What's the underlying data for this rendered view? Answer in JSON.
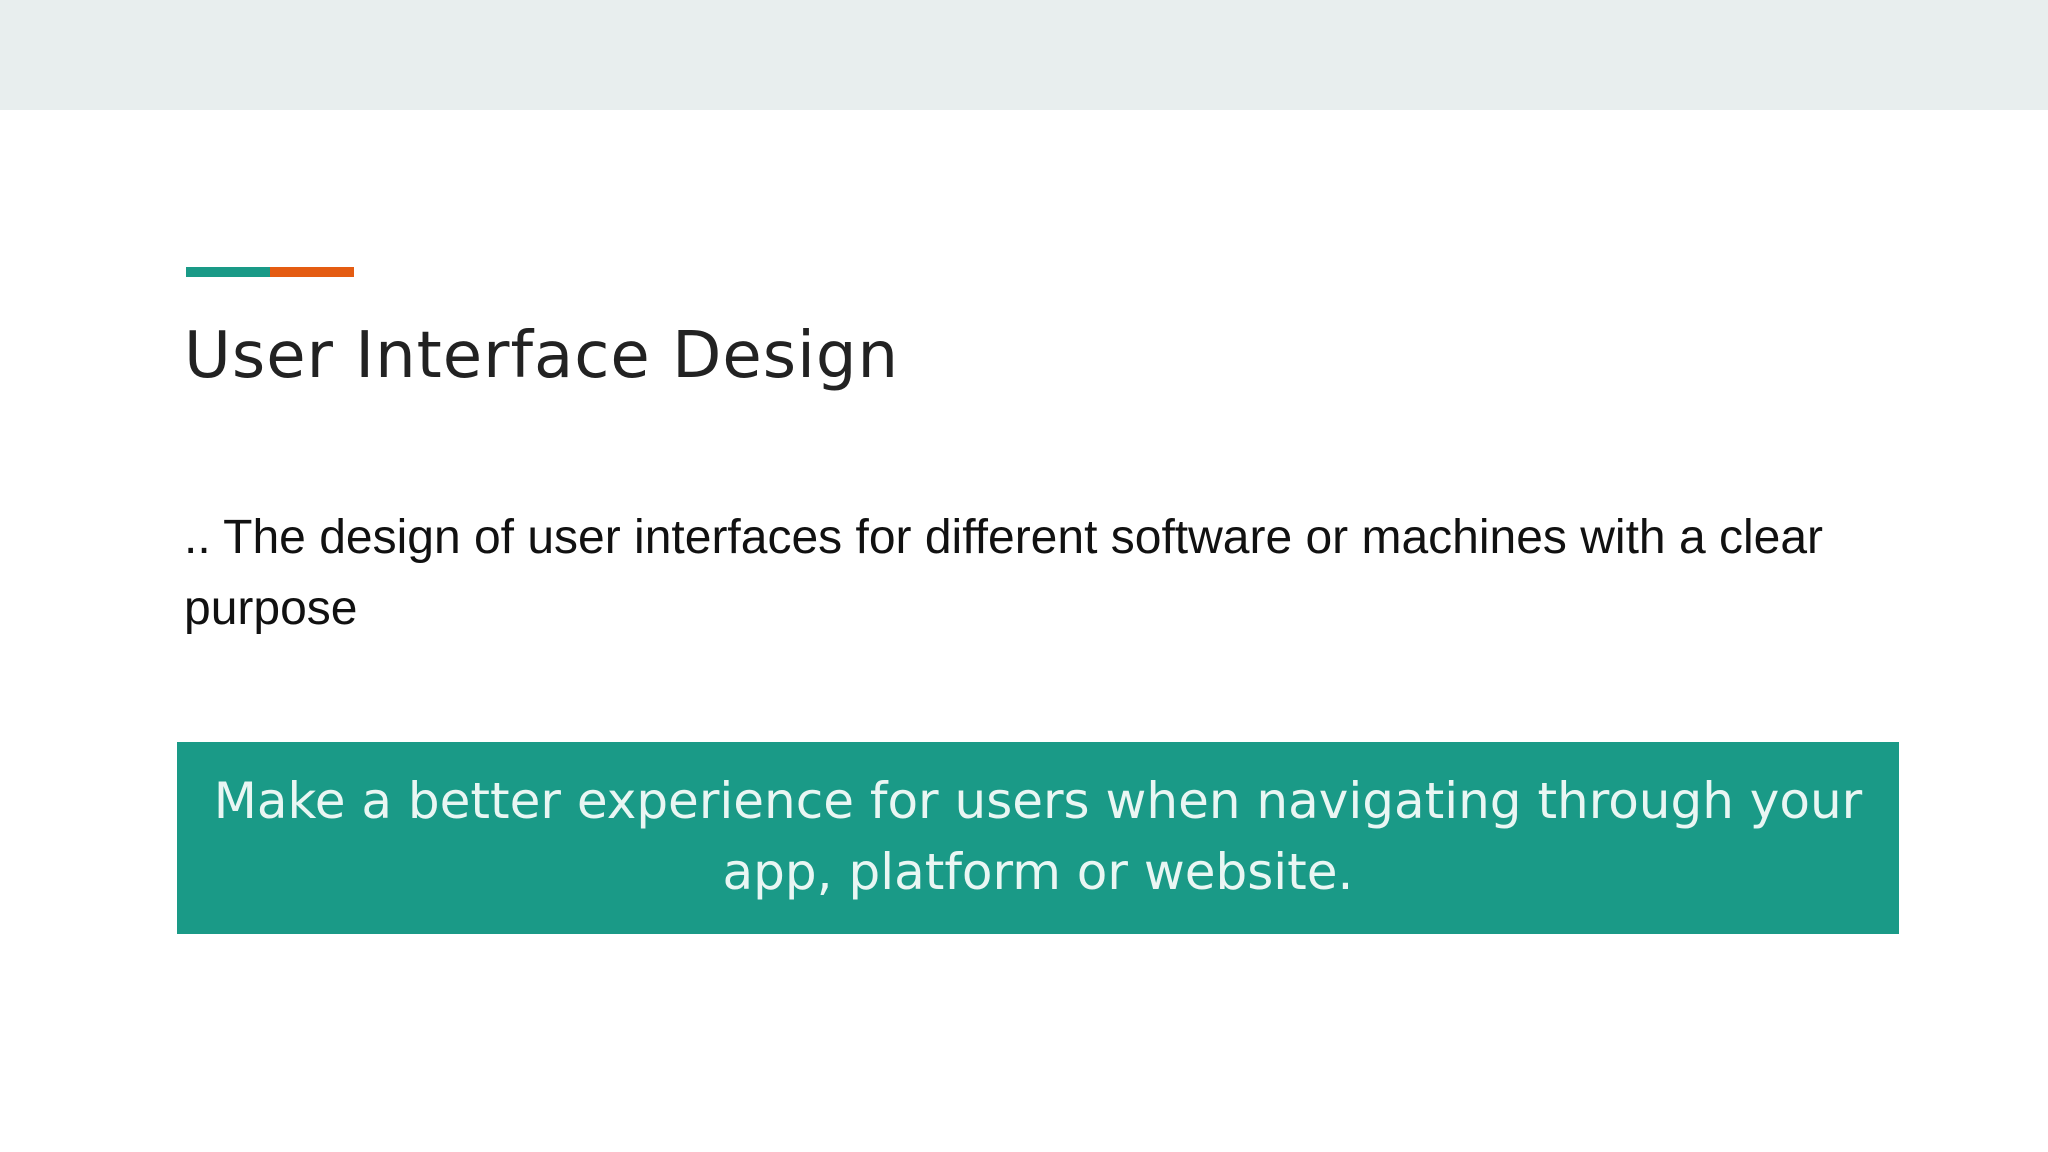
{
  "slide": {
    "title": "User Interface Design",
    "body": ".. The design of user interfaces for different software or machines with a clear purpose",
    "callout": "Make a better experience for users when navigating through your app, platform or website."
  },
  "colors": {
    "teal": "#1a9a87",
    "orange": "#e45c12",
    "top_band": "#e8eeee",
    "callout_bg": "#1a9a87"
  }
}
